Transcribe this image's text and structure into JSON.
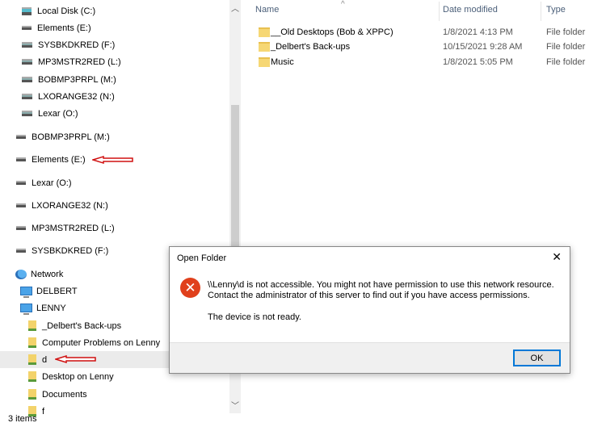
{
  "nav": {
    "drives_nested": [
      {
        "label": "Local Disk (C:)",
        "icon": "local-disk-icon"
      },
      {
        "label": "Elements (E:)",
        "icon": "drive-icon"
      },
      {
        "label": "SYSBKDKRED (F:)",
        "icon": "usb-drive-icon"
      },
      {
        "label": "MP3MSTR2RED (L:)",
        "icon": "usb-drive-icon"
      },
      {
        "label": "BOBMP3PRPL (M:)",
        "icon": "usb-drive-icon"
      },
      {
        "label": "LXORANGE32 (N:)",
        "icon": "usb-drive-icon"
      },
      {
        "label": "Lexar (O:)",
        "icon": "usb-drive-icon"
      }
    ],
    "drives": [
      {
        "label": "BOBMP3PRPL (M:)"
      },
      {
        "label": "Elements (E:)"
      },
      {
        "label": "Lexar (O:)"
      },
      {
        "label": "LXORANGE32 (N:)"
      },
      {
        "label": "MP3MSTR2RED (L:)"
      },
      {
        "label": "SYSBKDKRED (F:)"
      }
    ],
    "network": "Network",
    "computers": [
      "DELBERT",
      "LENNY"
    ],
    "shares": [
      "_Delbert's Back-ups",
      "Computer Problems on Lenny",
      "d",
      "Desktop on Lenny",
      "Documents",
      "f"
    ],
    "selected": "d"
  },
  "status": "3 items",
  "columns": {
    "name": "Name",
    "date": "Date modified",
    "type": "Type"
  },
  "files": [
    {
      "name": "__Old Desktops (Bob & XPPC)",
      "date": "1/8/2021 4:13 PM",
      "type": "File folder"
    },
    {
      "name": "_Delbert's Back-ups",
      "date": "10/15/2021 9:28 AM",
      "type": "File folder"
    },
    {
      "name": "Music",
      "date": "1/8/2021 5:05 PM",
      "type": "File folder"
    }
  ],
  "dialog": {
    "title": "Open Folder",
    "line1": "\\\\Lenny\\d is not accessible. You might not have permission to use this network resource.",
    "line2": "Contact the administrator of this server to find out if you have access permissions.",
    "line3": "The device is not ready.",
    "ok": "OK",
    "close": "✕",
    "icon": "error-icon"
  },
  "colors": {
    "annotation_arrow": "#d01010",
    "error": "#e0401c",
    "accent": "#0078d7"
  }
}
